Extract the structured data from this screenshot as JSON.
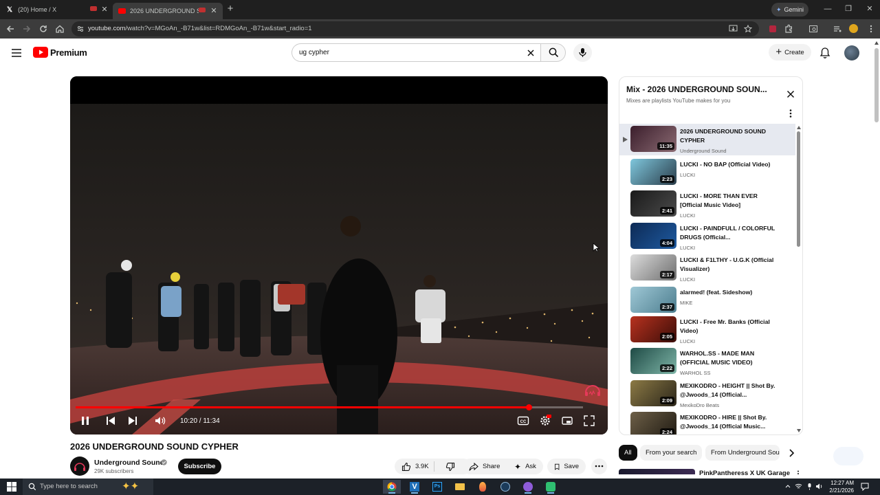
{
  "browser": {
    "tabs": [
      {
        "title": "(20) Home / X",
        "active": false
      },
      {
        "title": "2026 UNDERGROUND SOU",
        "active": true
      }
    ],
    "url_domain": "youtube.com",
    "url_path": "/watch?v=MGoAn_-B71w&list=RDMGoAn_-B71w&start_radio=1",
    "gemini_label": "Gemini"
  },
  "header": {
    "logo_text": "Premium",
    "search_value": "ug cypher",
    "create_label": "Create"
  },
  "player": {
    "time_text": "10:20 / 11:34",
    "progress": 0.8934
  },
  "video": {
    "title": "2026 UNDERGROUND SOUND CYPHER",
    "channel": "Underground Sound",
    "subscribers": "29K subscribers",
    "subscribe_label": "Subscribe",
    "likes": "3.9K",
    "share_label": "Share",
    "ask_label": "Ask",
    "save_label": "Save"
  },
  "playlist": {
    "title": "Mix - 2026 UNDERGROUND SOUN...",
    "subtitle": "Mixes are playlists YouTube makes for you",
    "items": [
      {
        "title": "2026 UNDERGROUND SOUND CYPHER",
        "channel": "Underground Sound",
        "duration": "11:35",
        "active": true,
        "thumb_a": "#3b1e2c",
        "thumb_b": "#8a6a72"
      },
      {
        "title": "LUCKI - NO BAP (Official Video)",
        "channel": "LUCKI",
        "duration": "2:23",
        "active": false,
        "thumb_a": "#7fc7dd",
        "thumb_b": "#2a3d4a"
      },
      {
        "title": "LUCKI - MORE THAN EVER [Official Music Video]",
        "channel": "LUCKI",
        "duration": "2:41",
        "active": false,
        "thumb_a": "#1a1a1a",
        "thumb_b": "#4b4b4b"
      },
      {
        "title": "LUCKI - PAINDFULL / COLORFUL DRUGS (Official...",
        "channel": "LUCKI",
        "duration": "4:04",
        "active": false,
        "thumb_a": "#0d2a55",
        "thumb_b": "#1e5aa0"
      },
      {
        "title": "LUCKI & F1LTHY - U.G.K (Official Visualizer)",
        "channel": "LUCKI",
        "duration": "2:17",
        "active": false,
        "thumb_a": "#dcdcdc",
        "thumb_b": "#6e6e6e"
      },
      {
        "title": "alarmed! (feat. Sideshow)",
        "channel": "MIKE",
        "duration": "2:37",
        "active": false,
        "thumb_a": "#9fc8d6",
        "thumb_b": "#4c7d8e"
      },
      {
        "title": "LUCKI - Free Mr. Banks (Official Video)",
        "channel": "LUCKI",
        "duration": "2:05",
        "active": false,
        "thumb_a": "#b8321f",
        "thumb_b": "#3b0d08"
      },
      {
        "title": "WARHOL.SS - MADE MAN (OFFICIAL MUSIC VIDEO)",
        "channel": "WARHOL SS",
        "duration": "2:22",
        "active": false,
        "thumb_a": "#1e4a45",
        "thumb_b": "#7fb6a8"
      },
      {
        "title": "MEXIKODRO - HEIGHT || Shot By. @Jwoods_14 (Official...",
        "channel": "MexikoDro Beats",
        "duration": "2:09",
        "active": false,
        "thumb_a": "#8c7a45",
        "thumb_b": "#2b261a"
      },
      {
        "title": "MEXIKODRO - HIRE || Shot By. @Jwoods_14 (Official Music...",
        "channel": "MexikoDro Beats",
        "duration": "2:24",
        "active": false,
        "thumb_a": "#6e6048",
        "thumb_b": "#1f1a12"
      }
    ]
  },
  "chips": [
    "All",
    "From your search",
    "From Underground Sou"
  ],
  "recommendation": {
    "title": "PinkPantheress X UK Garage"
  },
  "taskbar": {
    "search_placeholder": "Type here to search",
    "time": "12:27 AM",
    "date": "2/21/2026"
  },
  "colors": {
    "accent": "#ff0000",
    "chip_active": "#0f0f0f"
  }
}
